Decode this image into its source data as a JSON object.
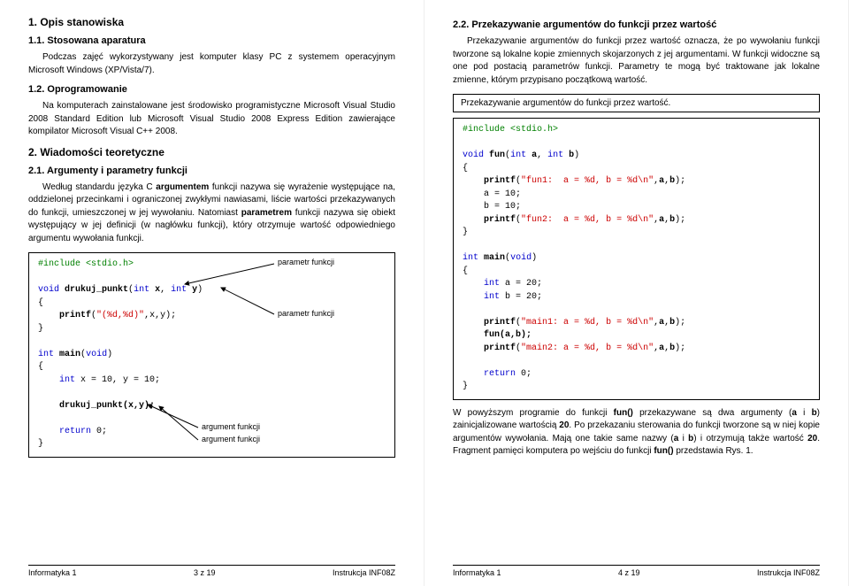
{
  "left": {
    "h1": "1. Opis stanowiska",
    "h11": "1.1. Stosowana aparatura",
    "p11": "Podczas zajęć wykorzystywany jest komputer klasy PC z systemem operacyjnym Microsoft Windows (XP/Vista/7).",
    "h12": "1.2. Oprogramowanie",
    "p12": "Na komputerach zainstalowane jest środowisko programistyczne Microsoft Visual Studio 2008 Standard Edition lub Microsoft Visual Studio 2008 Express Edition zawierające kompilator Microsoft Visual C++ 2008.",
    "h2": "2. Wiadomości teoretyczne",
    "h21": "2.1. Argumenty i parametry funkcji",
    "p21a_1": "Według standardu języka C ",
    "p21a_arg": "argumentem",
    "p21a_2": " funkcji nazywa się wyrażenie występujące na, oddzielonej przecinkami i ograniczonej zwykłymi nawiasami, liście wartości przekazywanych do funkcji, umieszczonej w jej wywołaniu. Natomiast ",
    "p21a_par": "parametrem",
    "p21a_3": " funkcji nazywa się obiekt występujący w jej definicji (w nagłówku funkcji), który otrzymuje wartość odpowiedniego argumentu wywołania funkcji.",
    "code1": {
      "inc": "#include <stdio.h>",
      "void": "void",
      "fname": "drukuj_punkt",
      "int": "int",
      "x": "x",
      "y": "y",
      "printf": "printf",
      "fmt": "\"(%d,%d)\"",
      "args": ",x,y);",
      "main": "main",
      "voidarg": "void",
      "decl": "x = 10, y = 10;",
      "call": "drukuj_punkt(x,y);",
      "ret": "return",
      "zero": " 0;"
    },
    "lbl_param": "parametr funkcji",
    "lbl_arg": "argument funkcji",
    "footer_left": "Informatyka 1",
    "footer_mid": "3 z 19",
    "footer_right": "Instrukcja INF08Z"
  },
  "right": {
    "h22": "2.2. Przekazywanie argumentów do funkcji przez wartość",
    "p22": "Przekazywanie argumentów do funkcji przez wartość oznacza, że po wywołaniu funkcji tworzone są lokalne kopie zmiennych skojarzonych z jej argumentami. W funkcji widoczne są one pod postacią parametrów funkcji. Parametry te mogą być traktowane jak lokalne zmienne, którym przypisano początkową wartość.",
    "frame": "Przekazywanie argumentów do funkcji przez wartość.",
    "code2": {
      "inc": "#include <stdio.h>",
      "void": "void",
      "fun": "fun",
      "int": "int",
      "a": "a",
      "b": "b",
      "printf": "printf",
      "f1": "\"fun1:  a = %d, b = %d\\n\"",
      "a10": "a = 10;",
      "b10": "b = 10;",
      "f2": "\"fun2:  a = %d, b = %d\\n\"",
      "main": "main",
      "voidarg": "void",
      "a20": "a = 20;",
      "b20": "b = 20;",
      "m1": "\"main1: a = %d, b = %d\\n\"",
      "call": "fun(a,b);",
      "m2": "\"main2: a = %d, b = %d\\n\"",
      "ret": "return",
      "zero": " 0;"
    },
    "p_after_1": "W powyższym programie do funkcji ",
    "p_after_fun": "fun()",
    "p_after_2": " przekazywane są dwa argumenty (",
    "p_after_a": "a",
    "p_after_and": " i ",
    "p_after_b": "b",
    "p_after_3": ") zainicjalizowane wartością ",
    "p_after_20": "20",
    "p_after_4": ". Po przekazaniu sterowania do funkcji tworzone są w niej kopie argumentów wywołania. Mają one takie same nazwy (",
    "p_after_5": ") i otrzymują także wartość ",
    "p_after_6": ". Fragment pamięci komputera po wejściu do funkcji ",
    "p_after_7": " przedstawia Rys. 1.",
    "footer_left": "Informatyka 1",
    "footer_mid": "4 z 19",
    "footer_right": "Instrukcja INF08Z"
  }
}
